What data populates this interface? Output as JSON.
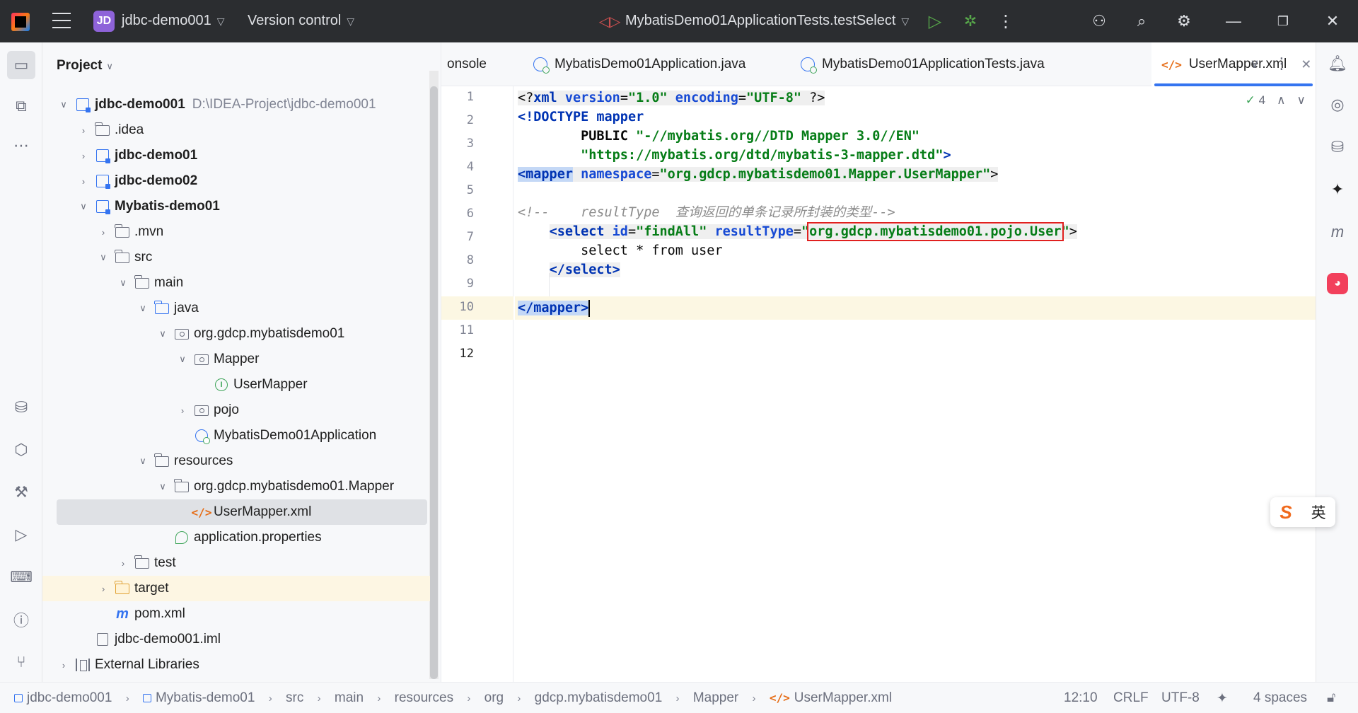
{
  "titlebar": {
    "project_badge": "JD",
    "project_name": "jdbc-demo001",
    "version_control": "Version control",
    "run_config": "MybatisDemo01ApplicationTests.testSelect"
  },
  "project_panel": {
    "title": "Project",
    "tree": [
      {
        "label": "jdbc-demo001",
        "path": "D:\\IDEA-Project\\jdbc-demo001"
      },
      {
        "label": ".idea"
      },
      {
        "label": "jdbc-demo01"
      },
      {
        "label": "jdbc-demo02"
      },
      {
        "label": "Mybatis-demo01"
      },
      {
        "label": ".mvn"
      },
      {
        "label": "src"
      },
      {
        "label": "main"
      },
      {
        "label": "java"
      },
      {
        "label": "org.gdcp.mybatisdemo01"
      },
      {
        "label": "Mapper"
      },
      {
        "label": "UserMapper"
      },
      {
        "label": "pojo"
      },
      {
        "label": "MybatisDemo01Application"
      },
      {
        "label": "resources"
      },
      {
        "label": "org.gdcp.mybatisdemo01.Mapper"
      },
      {
        "label": "UserMapper.xml"
      },
      {
        "label": "application.properties"
      },
      {
        "label": "test"
      },
      {
        "label": "target"
      },
      {
        "label": "pom.xml"
      },
      {
        "label": "jdbc-demo001.iml"
      },
      {
        "label": "External Libraries"
      }
    ]
  },
  "tabs": [
    {
      "label": "onsole"
    },
    {
      "label": "MybatisDemo01Application.java"
    },
    {
      "label": "MybatisDemo01ApplicationTests.java"
    },
    {
      "label": "UserMapper.xml",
      "close": "✕"
    }
  ],
  "editor": {
    "inspection_count": "4",
    "line_numbers": [
      "1",
      "2",
      "3",
      "4",
      "5",
      "6",
      "7",
      "8",
      "9",
      "10",
      "11",
      "12"
    ],
    "lines": {
      "l1": {
        "a": "<?",
        "b": "xml",
        "c": " version",
        "d": "=",
        "e": "\"1.0\"",
        "f": " encoding",
        "g": "=",
        "h": "\"UTF-8\"",
        "i": " ?>"
      },
      "l2": {
        "a": "<!DOCTYPE ",
        "b": "mapper"
      },
      "l3": {
        "a": "        PUBLIC ",
        "b": "\"-//mybatis.org//DTD Mapper 3.0//EN\""
      },
      "l4": {
        "a": "        ",
        "b": "\"https://mybatis.org/dtd/mybatis-3-mapper.dtd\"",
        "c": ">"
      },
      "l5": {
        "a": "<mapper",
        "b": " namespace",
        "c": "=",
        "d": "\"org.gdcp.mybatisdemo01.Mapper.UserMapper\"",
        "e": ">"
      },
      "l7": {
        "a": "<!--    resultType  查询返回的单条记录所封装的类型-->"
      },
      "l8": {
        "a": "    ",
        "b": "<select",
        "c": " id",
        "d": "=",
        "e": "\"findAll\"",
        "f": " resultType",
        "g": "=",
        "h": "\"",
        "i": "org.gdcp.mybatisdemo01.pojo.User",
        "j": "\"",
        "k": ">"
      },
      "l9": {
        "a": "        select * from user"
      },
      "l10": {
        "a": "    ",
        "b": "</select>"
      },
      "l12": {
        "a": "</mapper>"
      }
    }
  },
  "ime": {
    "label": "英"
  },
  "statusbar": {
    "crumbs": [
      "jdbc-demo001",
      "Mybatis-demo01",
      "src",
      "main",
      "resources",
      "org",
      "gdcp.mybatisdemo01",
      "Mapper",
      "UserMapper.xml"
    ],
    "position": "12:10",
    "line_ending": "CRLF",
    "encoding": "UTF-8",
    "indent": "4 spaces"
  }
}
